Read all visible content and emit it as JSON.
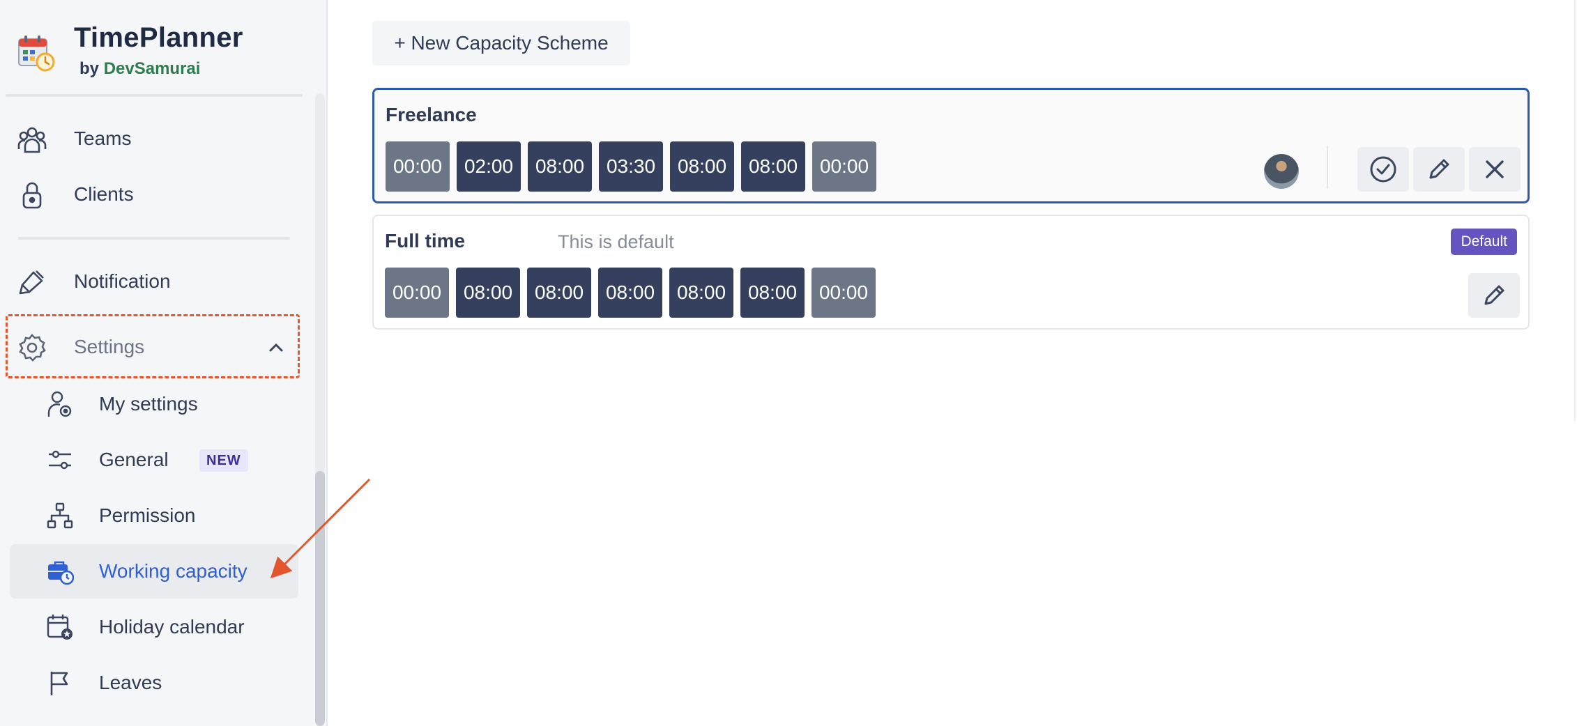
{
  "brand": {
    "title": "TimePlanner",
    "by": "by",
    "company": "DevSamurai"
  },
  "nav": {
    "teams": "Teams",
    "clients": "Clients",
    "notification": "Notification",
    "settings": "Settings",
    "sub": {
      "my_settings": "My settings",
      "general": "General",
      "general_badge": "NEW",
      "permission": "Permission",
      "working_capacity": "Working capacity",
      "holiday_calendar": "Holiday calendar",
      "leaves": "Leaves"
    }
  },
  "main": {
    "new_scheme_label": "+ New Capacity Scheme",
    "schemes": [
      {
        "name": "Freelance",
        "slots": [
          "00:00",
          "02:00",
          "08:00",
          "03:30",
          "08:00",
          "08:00",
          "00:00"
        ]
      },
      {
        "name": "Full time",
        "subtitle": "This is default",
        "badge": "Default",
        "slots": [
          "00:00",
          "08:00",
          "08:00",
          "08:00",
          "08:00",
          "08:00",
          "00:00"
        ]
      }
    ]
  },
  "colors": {
    "accent": "#2f5fd0",
    "slot_dark": "#34405e",
    "slot_light": "#6c7686",
    "default_badge": "#6554c0",
    "highlight": "#e4572e"
  }
}
